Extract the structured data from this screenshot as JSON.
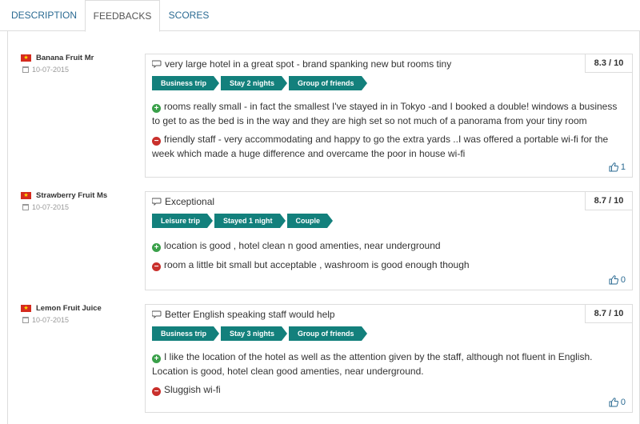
{
  "tabs": [
    {
      "label": "DESCRIPTION"
    },
    {
      "label": "FEEDBACKS"
    },
    {
      "label": "SCORES"
    }
  ],
  "reviews": [
    {
      "name": "Banana Fruit Mr",
      "date": "10-07-2015",
      "score": "8.3 / 10",
      "title": "very large hotel in a great spot - brand spanking new but rooms tiny",
      "tags": [
        "Business trip",
        "Stay 2 nights",
        "Group of friends"
      ],
      "positive": "rooms really small - in fact the smallest I've stayed in in Tokyo -and I booked a double! windows a business to get to as the bed is in the way and they are high set so not much of a panorama from your tiny room",
      "negative": "friendly staff - very accommodating and happy to go the extra yards ..I was offered a portable wi-fi for the week which made a huge difference and overcame the poor in house wi-fi",
      "likes": "1"
    },
    {
      "name": "Strawberry Fruit Ms",
      "date": "10-07-2015",
      "score": "8.7 / 10",
      "title": "Exceptional",
      "tags": [
        "Leisure trip",
        "Stayed 1 night",
        "Couple"
      ],
      "positive": "location is good , hotel clean n good amenties, near underground",
      "negative": "room a little bit small but acceptable , washroom is good enough though",
      "likes": "0"
    },
    {
      "name": "Lemon Fruit Juice",
      "date": "10-07-2015",
      "score": "8.7 / 10",
      "title": "Better English speaking staff would help",
      "tags": [
        "Business trip",
        "Stay 3 nights",
        "Group of friends"
      ],
      "positive": "I like the location of the hotel as well as the attention given by the staff, although not fluent in English. Location is good, hotel clean good amenties, near underground.",
      "negative": "Sluggish wi-fi",
      "likes": "0"
    }
  ],
  "colors": {
    "accent": "#13807c",
    "link": "#2a6a92",
    "positive": "#3aa04a",
    "negative": "#c9302c",
    "flag": "#d52b1e"
  },
  "icons": {
    "flag": "vietnam-flag-icon",
    "date": "calendar-icon",
    "title": "comment-icon",
    "positive": "plus-circle-icon",
    "negative": "minus-circle-icon",
    "likes": "thumbs-up-icon"
  }
}
